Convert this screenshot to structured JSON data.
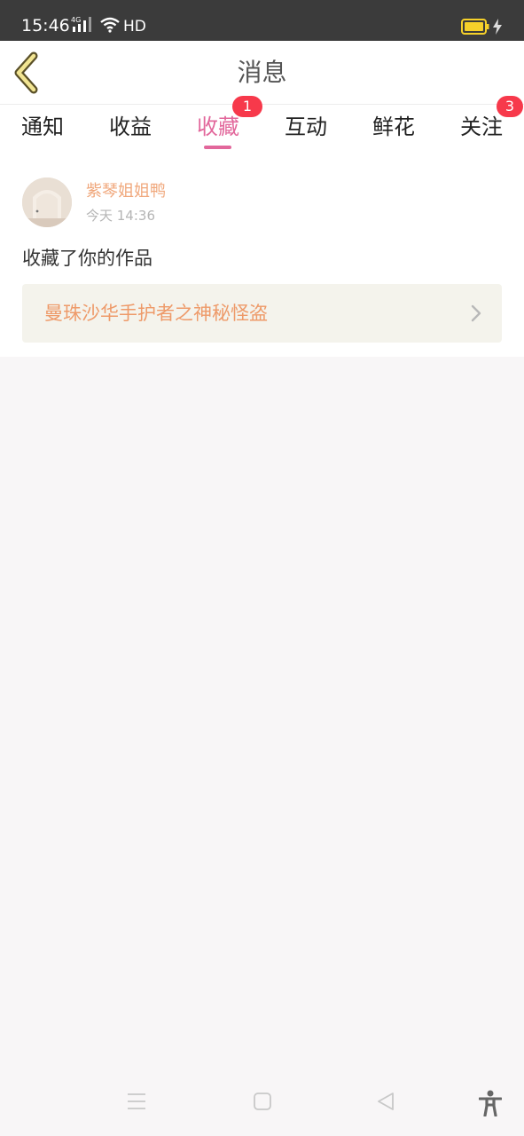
{
  "status_bar": {
    "time": "15:46",
    "network": "4G",
    "quality": "HD",
    "battery_color": "#f6d12a"
  },
  "header": {
    "title": "消息"
  },
  "tabs": [
    {
      "label": "通知",
      "badge": ""
    },
    {
      "label": "收益",
      "badge": ""
    },
    {
      "label": "收藏",
      "badge": "1",
      "active": true
    },
    {
      "label": "互动",
      "badge": ""
    },
    {
      "label": "鲜花",
      "badge": ""
    },
    {
      "label": "关注",
      "badge": "3"
    }
  ],
  "message": {
    "username": "紫琴姐姐鸭",
    "time": "今天 14:36",
    "action": "收藏了你的作品",
    "work_title": "曼珠沙华手护者之神秘怪盗"
  },
  "colors": {
    "accent": "#e2679b",
    "badge": "#f7394b",
    "username": "#f0a77b",
    "work_title": "#ee9a69"
  }
}
